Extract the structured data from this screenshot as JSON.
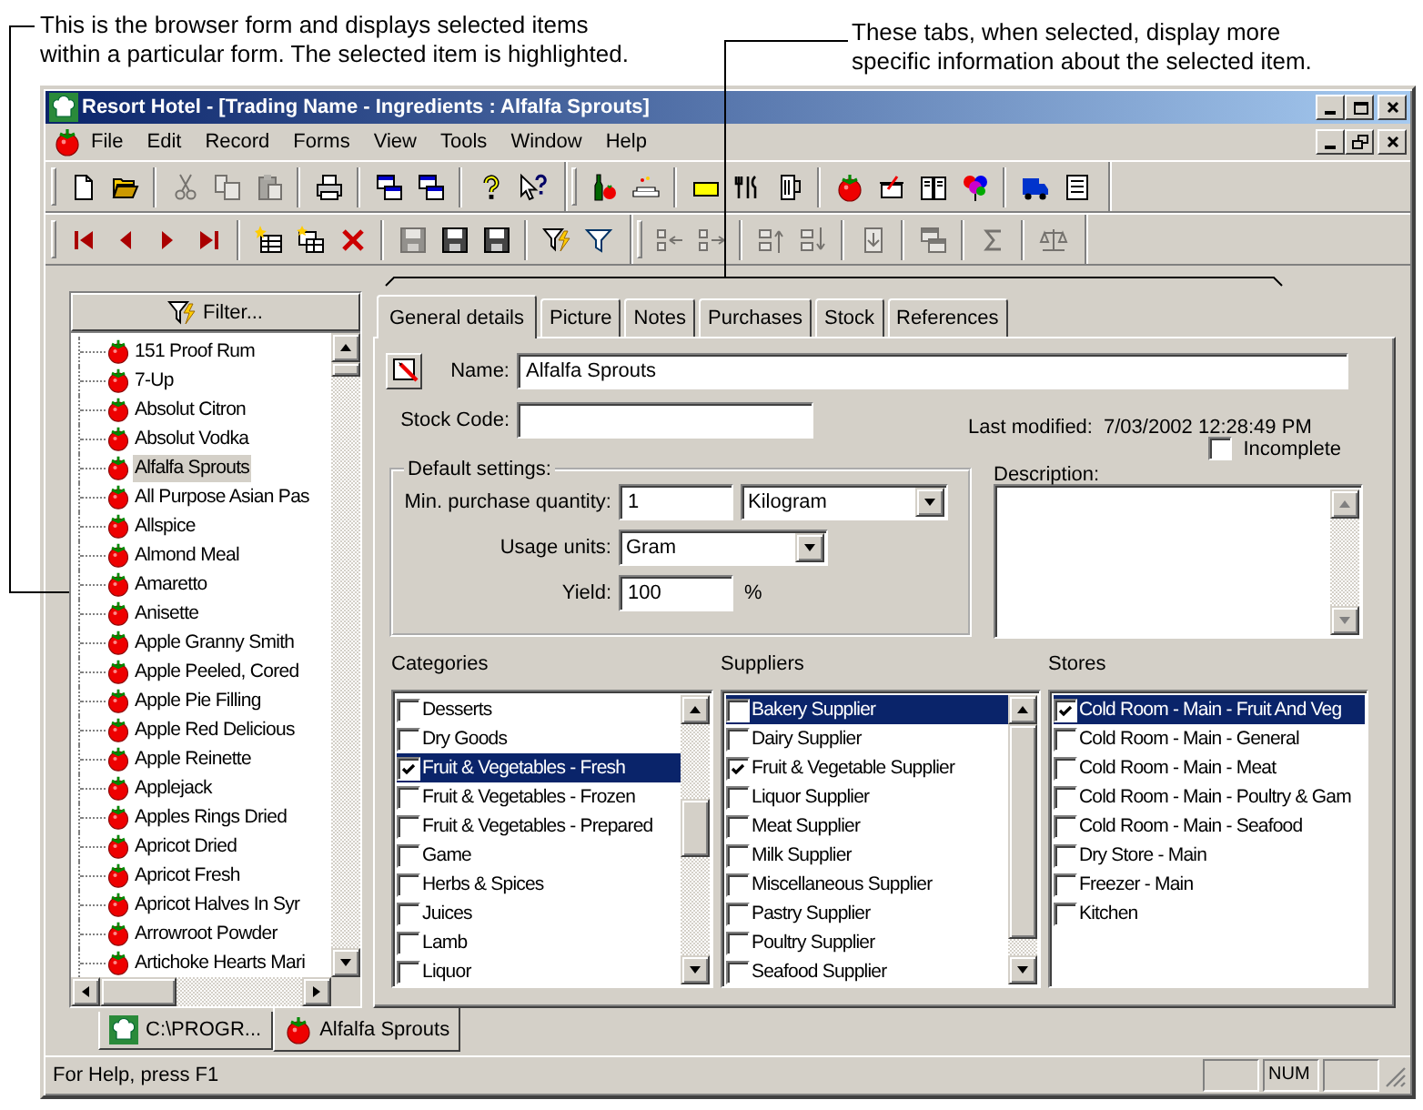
{
  "callouts": [
    {
      "text": "This is the browser form and displays selected items\nwithin a particular form. The selected item is highlighted."
    },
    {
      "text": "These tabs, when selected, display more\nspecific information about the selected item."
    }
  ],
  "window": {
    "title": "Resort Hotel - [Trading Name - Ingredients : Alfalfa Sprouts]"
  },
  "menu": [
    "File",
    "Edit",
    "Record",
    "Forms",
    "View",
    "Tools",
    "Window",
    "Help"
  ],
  "toolbar_rows": [
    {
      "toolbars": [
        {
          "groups": [
            [
              {
                "disabled": false
              },
              {
                "disabled": false
              }
            ],
            [
              {
                "disabled": true
              },
              {
                "disabled": true
              },
              {
                "disabled": true
              }
            ],
            [
              {
                "disabled": false
              }
            ],
            [
              {
                "disabled": false
              },
              {
                "disabled": false
              }
            ],
            [
              {
                "disabled": false
              },
              {
                "disabled": false
              }
            ]
          ]
        },
        {
          "groups": [
            [
              {
                "disabled": false
              },
              {
                "disabled": false
              }
            ],
            [
              {
                "disabled": false
              },
              {
                "disabled": false
              },
              {
                "disabled": false
              }
            ],
            [
              {
                "disabled": false
              },
              {
                "disabled": false
              },
              {
                "disabled": false
              },
              {
                "disabled": false
              }
            ],
            [
              {
                "disabled": false
              },
              {
                "disabled": false
              }
            ]
          ]
        }
      ]
    },
    {
      "toolbars": [
        {
          "groups": [
            [
              {
                "disabled": false
              },
              {
                "disabled": false
              },
              {
                "disabled": false
              },
              {
                "disabled": false
              }
            ],
            [
              {
                "disabled": false
              },
              {
                "disabled": false
              },
              {
                "disabled": false
              }
            ],
            [
              {
                "disabled": true
              },
              {
                "disabled": false
              },
              {
                "disabled": false
              }
            ],
            [
              {
                "disabled": false
              },
              {
                "disabled": false
              }
            ]
          ]
        },
        {
          "groups": [
            [
              {
                "disabled": true
              },
              {
                "disabled": true
              }
            ],
            [
              {
                "disabled": true
              },
              {
                "disabled": true
              }
            ],
            [
              {
                "disabled": true
              }
            ],
            [
              {
                "disabled": true
              }
            ],
            [
              {
                "disabled": true
              }
            ],
            [
              {
                "disabled": true
              }
            ]
          ]
        }
      ]
    }
  ],
  "browser": {
    "filter_button": "Filter...",
    "items": [
      {
        "label": "151 Proof Rum",
        "selected": false
      },
      {
        "label": "7-Up",
        "selected": false
      },
      {
        "label": "Absolut Citron",
        "selected": false
      },
      {
        "label": "Absolut Vodka",
        "selected": false
      },
      {
        "label": "Alfalfa Sprouts",
        "selected": true
      },
      {
        "label": "All Purpose Asian Pas",
        "selected": false
      },
      {
        "label": "Allspice",
        "selected": false
      },
      {
        "label": "Almond Meal",
        "selected": false
      },
      {
        "label": "Amaretto",
        "selected": false
      },
      {
        "label": "Anisette",
        "selected": false
      },
      {
        "label": "Apple Granny Smith",
        "selected": false
      },
      {
        "label": "Apple Peeled, Cored",
        "selected": false
      },
      {
        "label": "Apple Pie Filling",
        "selected": false
      },
      {
        "label": "Apple Red Delicious",
        "selected": false
      },
      {
        "label": "Apple Reinette",
        "selected": false
      },
      {
        "label": "Applejack",
        "selected": false
      },
      {
        "label": "Apples Rings Dried",
        "selected": false
      },
      {
        "label": "Apricot Dried",
        "selected": false
      },
      {
        "label": "Apricot Fresh",
        "selected": false
      },
      {
        "label": "Apricot Halves In Syr",
        "selected": false
      },
      {
        "label": "Arrowroot Powder",
        "selected": false
      },
      {
        "label": "Artichoke Hearts Mari",
        "selected": false
      }
    ]
  },
  "tabs": [
    {
      "label": "General details",
      "selected": true
    },
    {
      "label": "Picture",
      "selected": false
    },
    {
      "label": "Notes",
      "selected": false
    },
    {
      "label": "Purchases",
      "selected": false
    },
    {
      "label": "Stock",
      "selected": false
    },
    {
      "label": "References",
      "selected": false
    }
  ],
  "details": {
    "name_label": "Name:",
    "name": "Alfalfa Sprouts",
    "stock_code_label": "Stock Code:",
    "last_modified_label": "Last modified:",
    "last_modified": "7/03/2002 12:28:49 PM",
    "incomplete": {
      "label": "Incomplete",
      "checked": false
    },
    "default_settings": {
      "title": "Default settings:",
      "min_qty_label": "Min. purchase quantity:",
      "min_qty": "1",
      "min_qty_unit": "Kilogram",
      "usage_units_label": "Usage units:",
      "usage_units": "Gram",
      "yield_label": "Yield:",
      "yield": "100",
      "yield_unit": "%"
    },
    "description_label": "Description:"
  },
  "lists": [
    {
      "title": "Categories",
      "items": [
        {
          "label": "Desserts",
          "checked": false,
          "selected": false
        },
        {
          "label": "Dry Goods",
          "checked": false,
          "selected": false
        },
        {
          "label": "Fruit & Vegetables - Fresh",
          "checked": true,
          "selected": true
        },
        {
          "label": "Fruit & Vegetables - Frozen",
          "checked": false,
          "selected": false
        },
        {
          "label": "Fruit & Vegetables - Prepared",
          "checked": false,
          "selected": false
        },
        {
          "label": "Game",
          "checked": false,
          "selected": false
        },
        {
          "label": "Herbs & Spices",
          "checked": false,
          "selected": false
        },
        {
          "label": "Juices",
          "checked": false,
          "selected": false
        },
        {
          "label": "Lamb",
          "checked": false,
          "selected": false
        },
        {
          "label": "Liquor",
          "checked": false,
          "selected": false
        }
      ]
    },
    {
      "title": "Suppliers",
      "items": [
        {
          "label": "Bakery Supplier",
          "checked": false,
          "selected": true
        },
        {
          "label": "Dairy Supplier",
          "checked": false,
          "selected": false
        },
        {
          "label": "Fruit & Vegetable Supplier",
          "checked": true,
          "selected": false
        },
        {
          "label": "Liquor Supplier",
          "checked": false,
          "selected": false
        },
        {
          "label": "Meat Supplier",
          "checked": false,
          "selected": false
        },
        {
          "label": "Milk Supplier",
          "checked": false,
          "selected": false
        },
        {
          "label": "Miscellaneous Supplier",
          "checked": false,
          "selected": false
        },
        {
          "label": "Pastry Supplier",
          "checked": false,
          "selected": false
        },
        {
          "label": "Poultry Supplier",
          "checked": false,
          "selected": false
        },
        {
          "label": "Seafood Supplier",
          "checked": false,
          "selected": false
        }
      ]
    },
    {
      "title": "Stores",
      "items": [
        {
          "label": "Cold Room - Main - Fruit And Veg",
          "checked": true,
          "selected": true
        },
        {
          "label": "Cold Room - Main - General",
          "checked": false,
          "selected": false
        },
        {
          "label": "Cold Room - Main - Meat",
          "checked": false,
          "selected": false
        },
        {
          "label": "Cold Room - Main - Poultry & Gam",
          "checked": false,
          "selected": false
        },
        {
          "label": "Cold Room - Main - Seafood",
          "checked": false,
          "selected": false
        },
        {
          "label": "Dry Store - Main",
          "checked": false,
          "selected": false
        },
        {
          "label": "Freezer - Main",
          "checked": false,
          "selected": false
        },
        {
          "label": "Kitchen",
          "checked": false,
          "selected": false
        }
      ]
    }
  ],
  "document_tabs": [
    {
      "label": "C:\\PROGR...",
      "kind": "app",
      "selected": false
    },
    {
      "label": "Alfalfa Sprouts",
      "kind": "ingredient",
      "selected": true
    }
  ],
  "status_bar": {
    "text": "For Help, press F1",
    "indicators": [
      "NUM"
    ]
  }
}
